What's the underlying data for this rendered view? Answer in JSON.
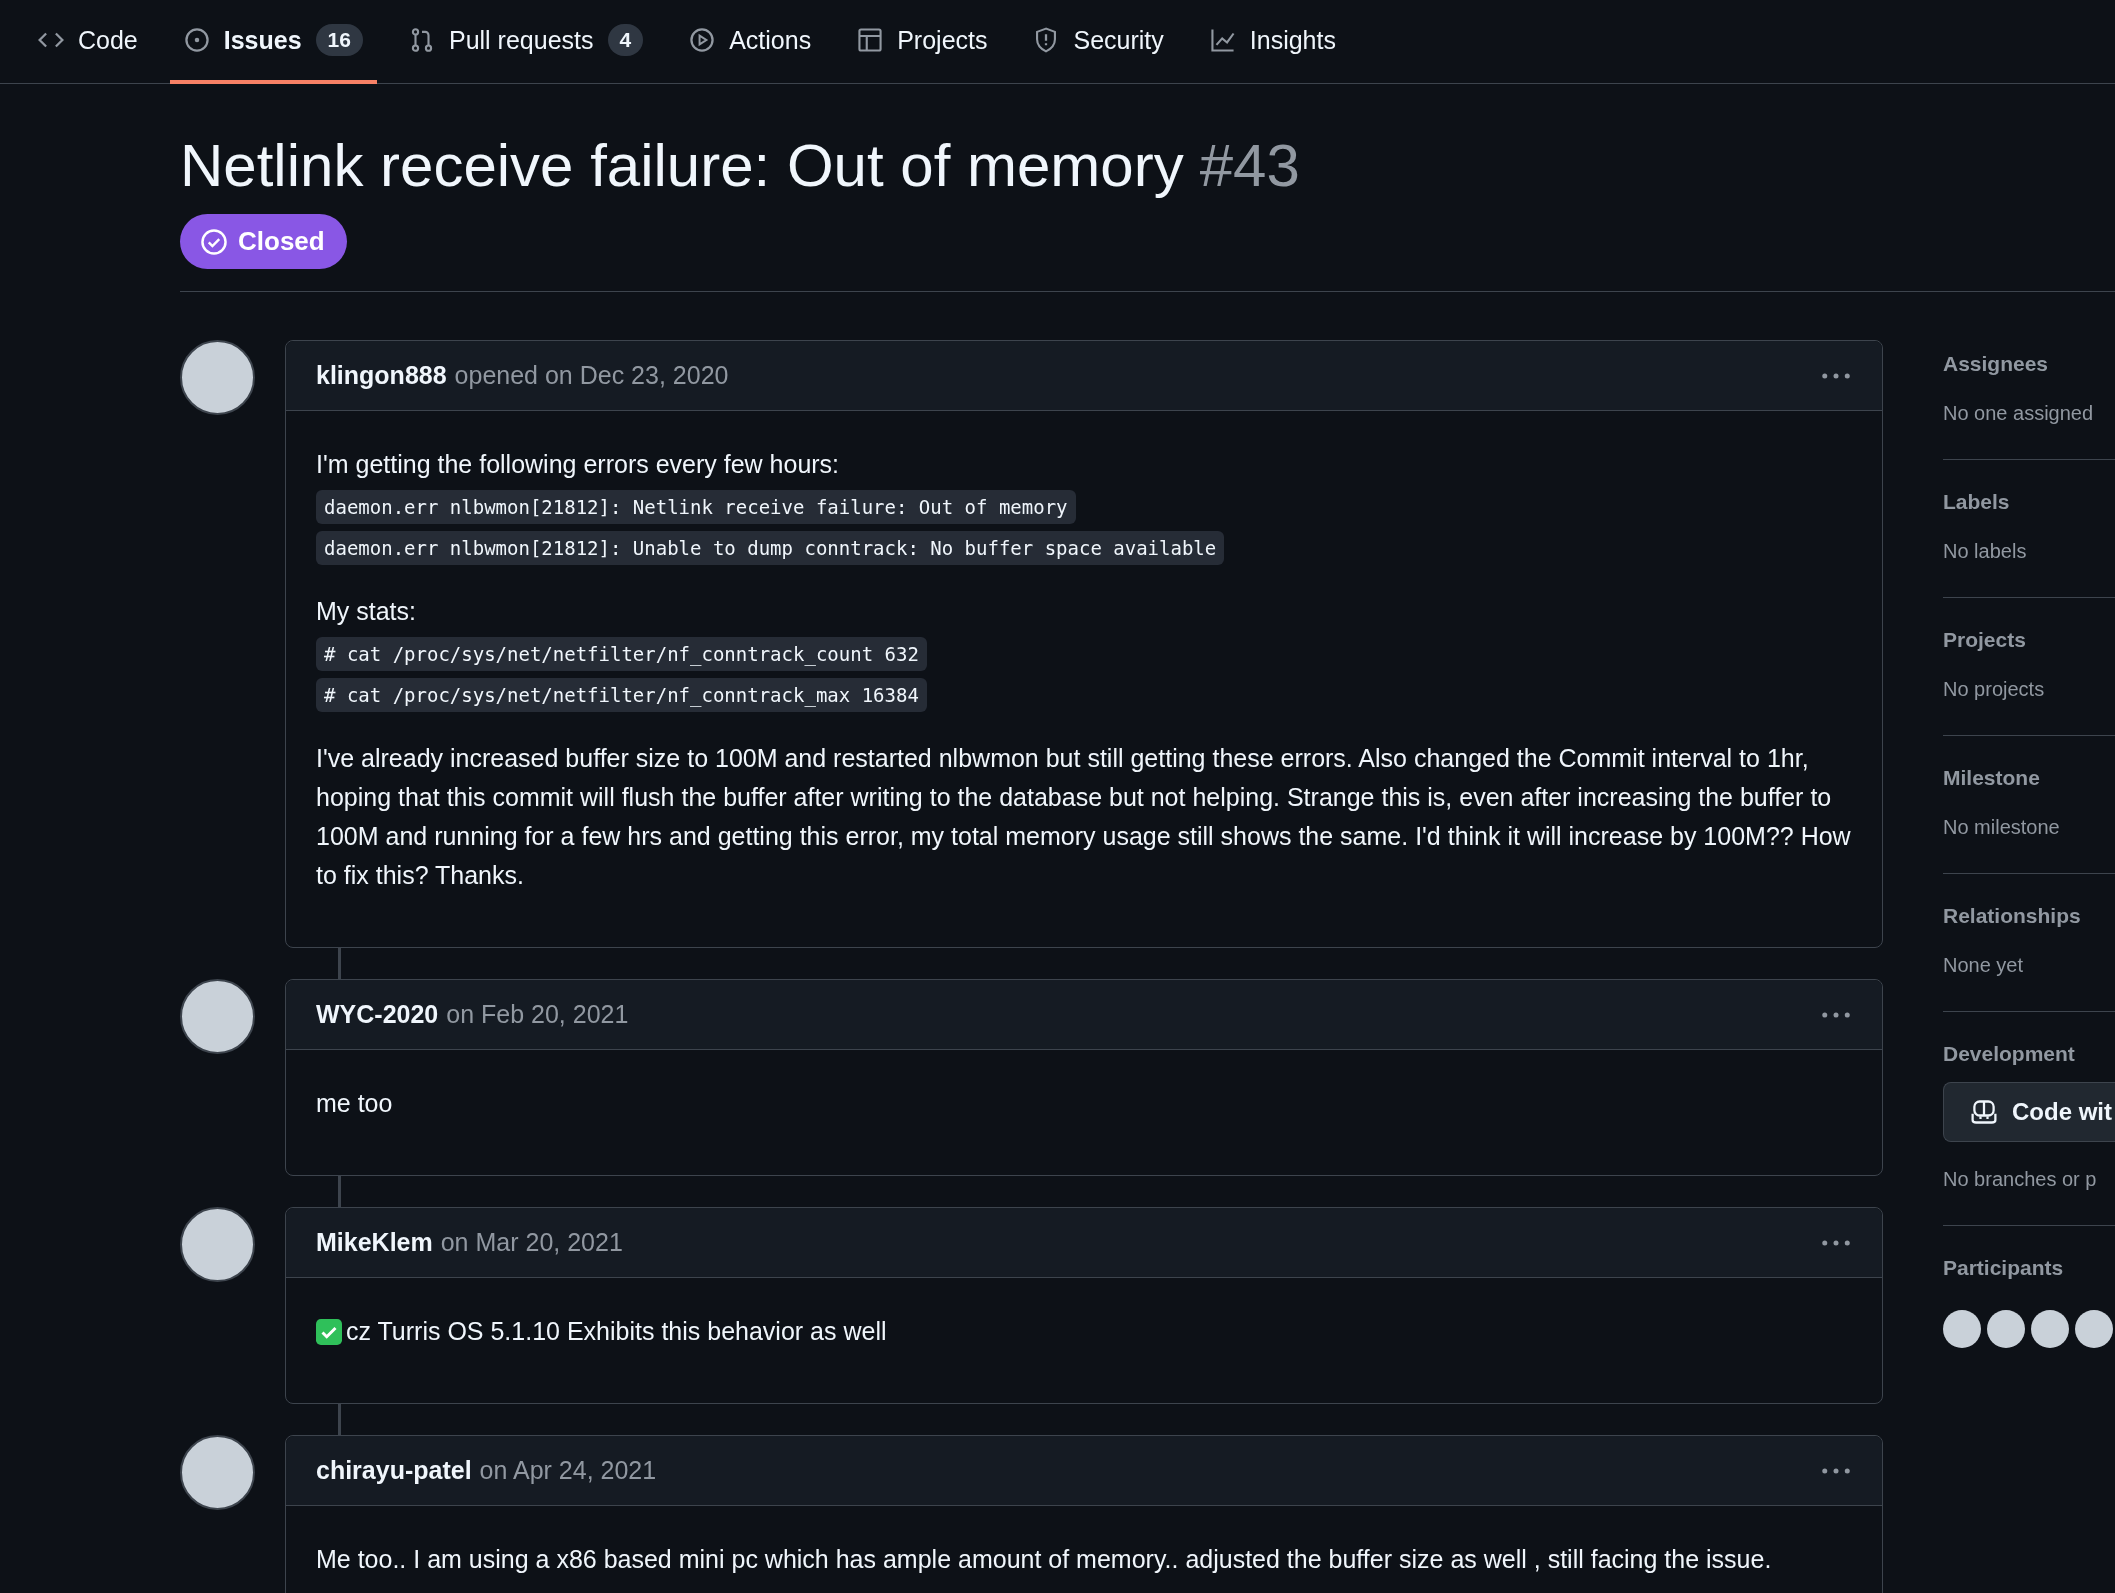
{
  "nav": {
    "tabs": [
      {
        "label": "Code",
        "selected": false
      },
      {
        "label": "Issues",
        "count": "16",
        "selected": true
      },
      {
        "label": "Pull requests",
        "count": "4",
        "selected": false
      },
      {
        "label": "Actions",
        "selected": false
      },
      {
        "label": "Projects",
        "selected": false
      },
      {
        "label": "Security",
        "selected": false
      },
      {
        "label": "Insights",
        "selected": false
      }
    ]
  },
  "issue": {
    "title": "Netlink receive failure: Out of memory",
    "number": "#43",
    "state": "Closed"
  },
  "comments": [
    {
      "author": "klingon888",
      "meta": "opened on Dec 23, 2020",
      "blocks": [
        {
          "kind": "p",
          "text": "I'm getting the following errors every few hours:"
        },
        {
          "kind": "code",
          "text": "daemon.err nlbwmon[21812]: Netlink receive failure: Out of memory"
        },
        {
          "kind": "code",
          "text": "daemon.err nlbwmon[21812]: Unable to dump conntrack: No buffer space available"
        },
        {
          "kind": "p",
          "text": "My stats:"
        },
        {
          "kind": "code",
          "text": "# cat /proc/sys/net/netfilter/nf_conntrack_count 632"
        },
        {
          "kind": "code",
          "text": "# cat /proc/sys/net/netfilter/nf_conntrack_max 16384"
        },
        {
          "kind": "p",
          "text": "I've already increased buffer size to 100M and restarted nlbwmon but still getting these errors. Also changed the Commit interval to 1hr, hoping that this commit will flush the buffer after writing to the database but not helping. Strange this is, even after increasing the buffer to 100M and running for a few hrs and getting this error, my total memory usage still shows the same. I'd think it will increase by 100M?? How to fix this? Thanks."
        }
      ]
    },
    {
      "author": "WYC-2020",
      "meta": "on Feb 20, 2021",
      "blocks": [
        {
          "kind": "p",
          "text": "me too"
        }
      ]
    },
    {
      "author": "MikeKlem",
      "meta": "on Mar 20, 2021",
      "blocks": [
        {
          "kind": "checked",
          "text": "cz Turris OS 5.1.10 Exhibits this behavior as well"
        }
      ]
    },
    {
      "author": "chirayu-patel",
      "meta": "on Apr 24, 2021",
      "blocks": [
        {
          "kind": "p",
          "text": "Me too.. I am using a x86 based mini pc which has ample amount of memory.. adjusted the buffer size as well , still facing the issue."
        }
      ]
    }
  ],
  "sidebar": {
    "sections": [
      {
        "kind": "text",
        "heading": "Assignees",
        "value": "No one assigned"
      },
      {
        "kind": "text",
        "heading": "Labels",
        "value": "No labels"
      },
      {
        "kind": "text",
        "heading": "Projects",
        "value": "No projects"
      },
      {
        "kind": "text",
        "heading": "Milestone",
        "value": "No milestone"
      },
      {
        "kind": "text",
        "heading": "Relationships",
        "value": "None yet"
      },
      {
        "kind": "button",
        "heading": "Development",
        "button": "Code wit",
        "value": "No branches or p"
      },
      {
        "kind": "avatars",
        "heading": "Participants"
      }
    ]
  }
}
